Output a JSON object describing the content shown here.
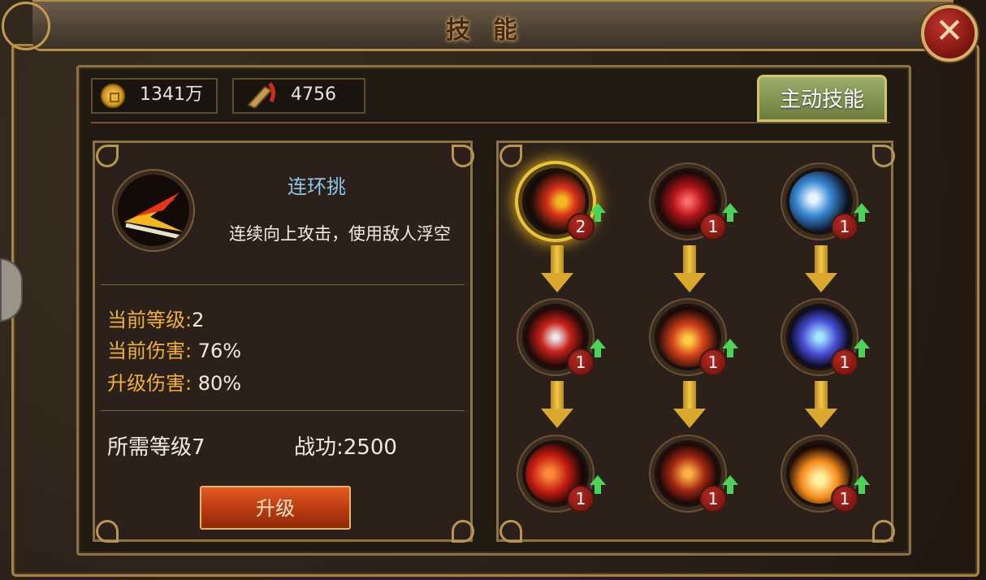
{
  "title": "技能",
  "close_icon": "close-icon",
  "resources": {
    "coins": "1341万",
    "feats": "4756"
  },
  "tabs": {
    "active_skills": "主动技能"
  },
  "detail": {
    "name": "连环挑",
    "description": "连续向上攻击，使用敌人浮空",
    "current_level_label": "当前等级:",
    "current_level_value": "2",
    "current_damage_label": "当前伤害:",
    "current_damage_value": " 76%",
    "upgrade_damage_label": "升级伤害:",
    "upgrade_damage_value": " 80%",
    "required_level": "所需等级7",
    "feat_cost": "战功:2500",
    "upgrade_button": "升级"
  },
  "skill_tree": [
    {
      "level": "2",
      "selected": true
    },
    {
      "level": "1",
      "selected": false
    },
    {
      "level": "1",
      "selected": false
    },
    {
      "level": "1",
      "selected": false
    },
    {
      "level": "1",
      "selected": false
    },
    {
      "level": "1",
      "selected": false
    },
    {
      "level": "1",
      "selected": false
    },
    {
      "level": "1",
      "selected": false
    },
    {
      "level": "1",
      "selected": false
    }
  ],
  "colors": {
    "accent_gold": "#d9a82c",
    "upgrade_green": "#4bd35a",
    "level_badge": "#b52a22"
  }
}
